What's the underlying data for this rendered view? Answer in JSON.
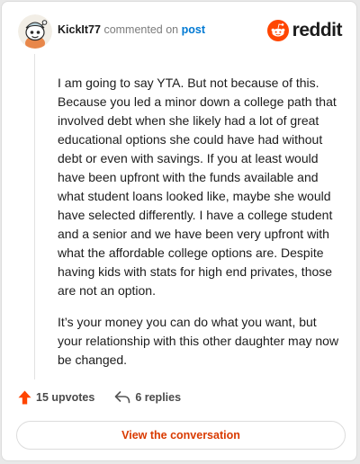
{
  "header": {
    "username": "KickIt77",
    "action_text": "commented on",
    "post_link": "post"
  },
  "brand": {
    "wordmark": "reddit",
    "icon": "reddit-alien-icon",
    "color": "#ff4500"
  },
  "avatar": {
    "icon": "snoo-avatar-icon"
  },
  "comment": {
    "paragraphs": [
      "I am going to say YTA. But not because of this. Because you led a minor down a college path that involved debt when she likely had a lot of great educational options she could have had without debt or even with savings. If you at least would have been upfront with the funds available and what student loans looked like, maybe she would have selected differently. I have a college student and a senior and we have been very upfront with what the affordable college options are. Despite having kids with stats for high end privates, those are not an option.",
      "It’s your money you can do what you want, but your relationship with this other daughter may now be changed."
    ]
  },
  "actions": {
    "upvotes": "15 upvotes",
    "replies": "6 replies",
    "upvote_icon": "upvote-arrow-icon",
    "reply_icon": "reply-arrow-icon"
  },
  "cta": {
    "label": "View the conversation",
    "color": "#d93a00"
  }
}
